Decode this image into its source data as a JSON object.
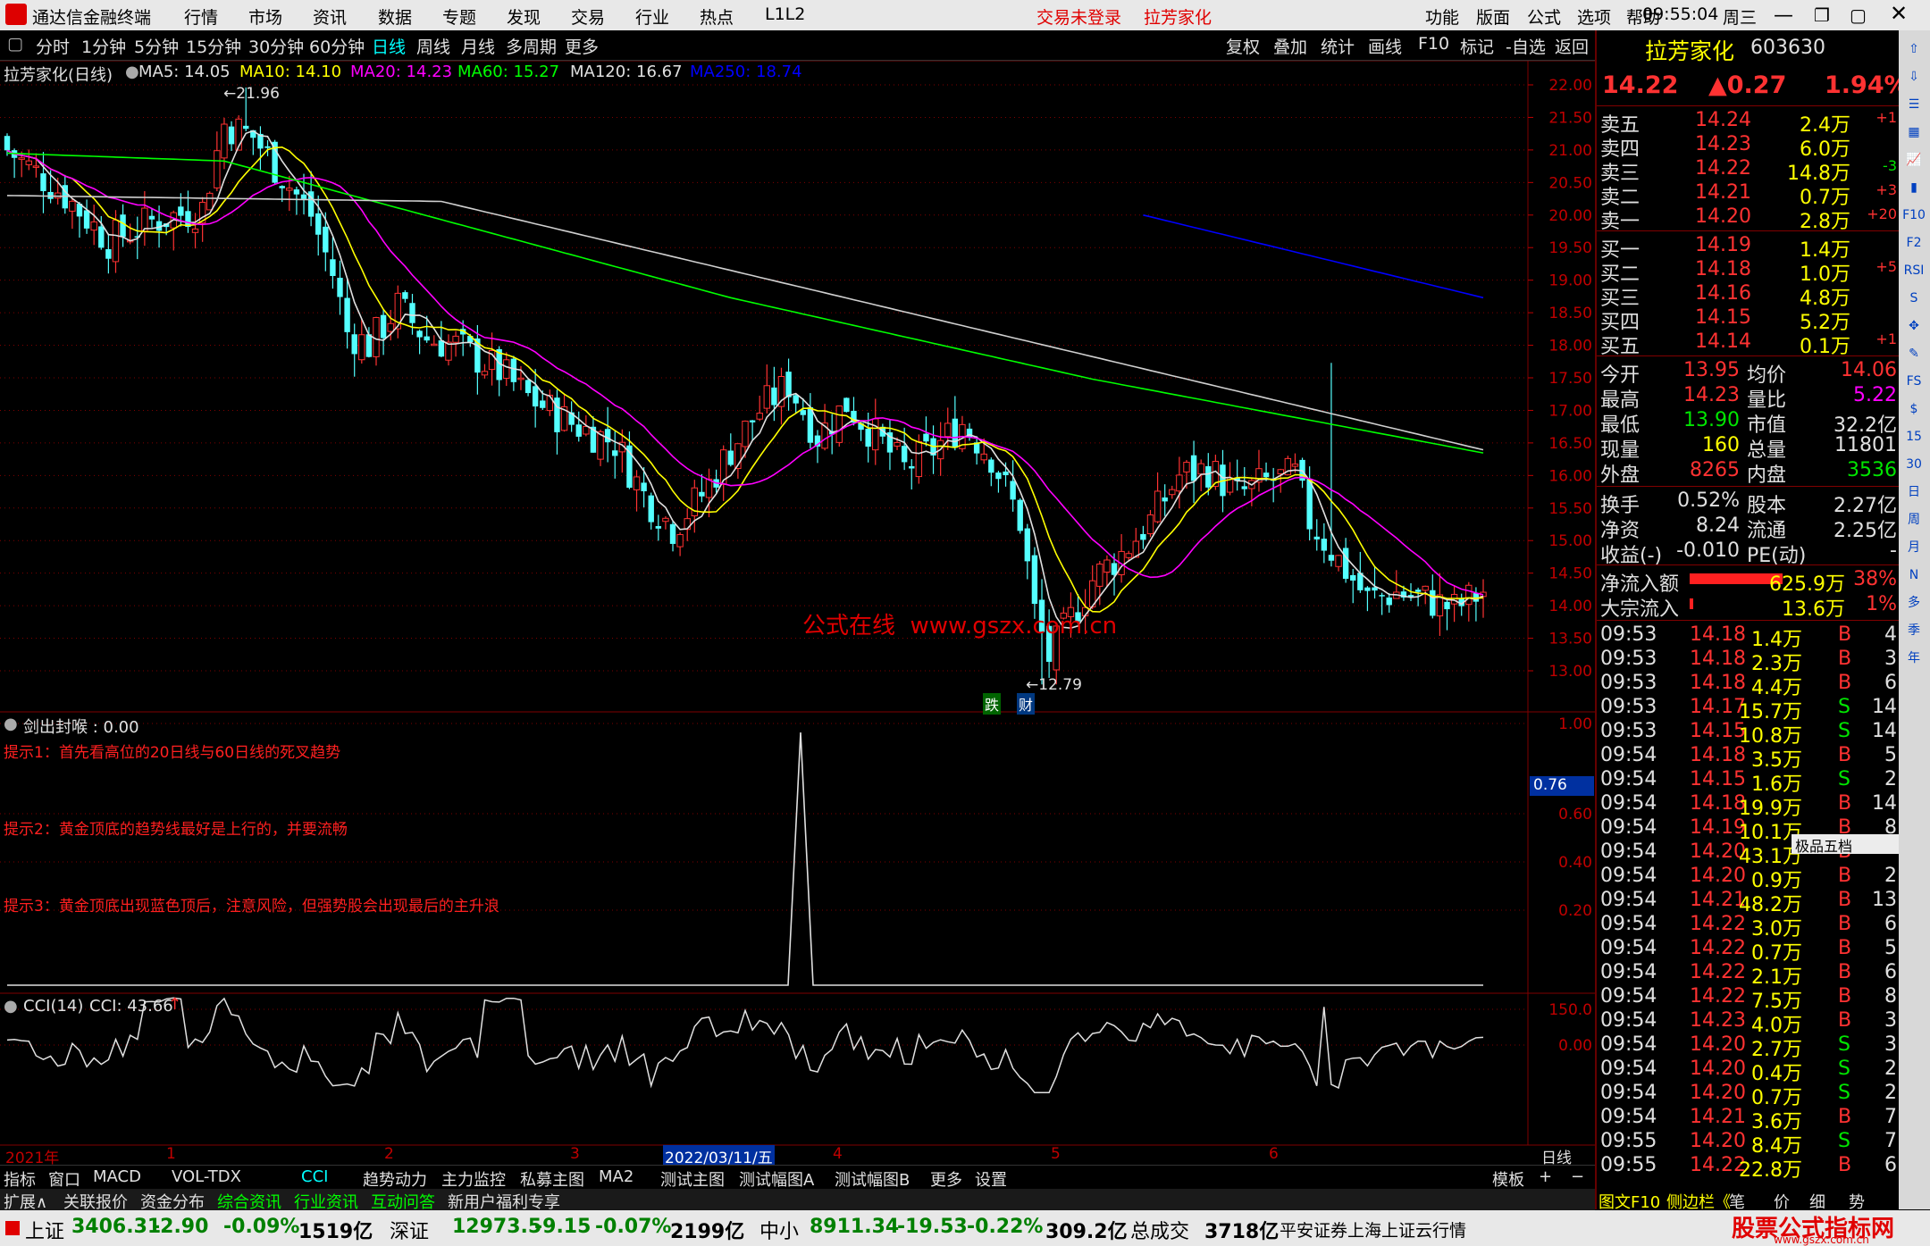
{
  "titlebar": {
    "app_title": "通达信金融终端",
    "menu": [
      "行情",
      "市场",
      "资讯",
      "数据",
      "专题",
      "发现",
      "交易",
      "行业",
      "热点",
      "L1L2"
    ],
    "login_status": "交易未登录",
    "stock_name": "拉芳家化",
    "right_menu": [
      "功能",
      "版面",
      "公式",
      "选项",
      "帮助"
    ],
    "time": "09:55:04",
    "weekday": "周三"
  },
  "period_tabs": [
    "分时",
    "1分钟",
    "5分钟",
    "15分钟",
    "30分钟",
    "60分钟",
    "日线",
    "周线",
    "月线",
    "多周期",
    "更多"
  ],
  "active_period": "日线",
  "chart_tools": [
    "复权",
    "叠加",
    "统计",
    "画线",
    "F10",
    "标记",
    "-自选",
    "返回"
  ],
  "main_chart": {
    "title": "拉芳家化(日线)",
    "ma_labels": [
      {
        "text": "MA5: 14.05",
        "color": "#e0e0e0"
      },
      {
        "text": "MA10: 14.10",
        "color": "#ffff00"
      },
      {
        "text": "MA20: 14.23",
        "color": "#ff00ff"
      },
      {
        "text": "MA60: 15.27",
        "color": "#00ff00"
      },
      {
        "text": "MA120: 16.67",
        "color": "#e0e0e0"
      },
      {
        "text": "MA250: 18.74",
        "color": "#0000ff"
      }
    ],
    "high_label": "21.96",
    "low_label": "12.79",
    "watermark": "公式在线  www.gszx.com.cn",
    "marker1": "跌",
    "marker2": "财",
    "y_ticks": [
      "22.00",
      "21.50",
      "21.00",
      "20.50",
      "20.00",
      "19.50",
      "19.00",
      "18.50",
      "18.00",
      "17.50",
      "17.00",
      "16.50",
      "16.00",
      "15.50",
      "15.00",
      "14.50",
      "14.00",
      "13.50",
      "13.00"
    ]
  },
  "indicator1": {
    "title": "剑出封喉 : 0.00",
    "hint1": "提示1：首先看高位的20日线与60日线的死叉趋势",
    "hint2": "提示2：黄金顶底的趋势线最好是上行的，并要流畅",
    "hint3": "提示3：黄金顶底出现蓝色顶后，注意风险，但强势股会出现最后的主升浪",
    "y_ticks": [
      "1.00",
      "0.60",
      "0.40",
      "0.20"
    ],
    "current_value": "0.76"
  },
  "indicator2": {
    "title": "CCI(14)",
    "value_label": "CCI: 43.66",
    "y_ticks": [
      "150.0",
      "0.00"
    ]
  },
  "x_axis": {
    "labels": [
      "2021年",
      "1",
      "2",
      "3",
      "2022/03/11/五",
      "4",
      "5",
      "6"
    ],
    "right_label": "日线"
  },
  "indicator_tabs": [
    "指标",
    "窗口",
    "MACD",
    "VOL-TDX",
    "CCI",
    "趋势动力",
    "主力监控",
    "私募主图",
    "MA2",
    "测试主图",
    "测试幅图A",
    "测试幅图B",
    "更多",
    "设置"
  ],
  "template_label": "模板",
  "bottom_tabs": [
    "扩展∧",
    "关联报价",
    "资金分布",
    "综合资讯",
    "行业资讯",
    "互动问答",
    "新用户福利专享"
  ],
  "quote": {
    "name": "拉芳家化",
    "code": "603630",
    "price": "14.22",
    "change": "▲0.27",
    "pct": "1.94%",
    "asks": [
      {
        "label": "卖五",
        "price": "14.24",
        "vol": "2.4万",
        "chg": "+1"
      },
      {
        "label": "卖四",
        "price": "14.23",
        "vol": "6.0万",
        "chg": ""
      },
      {
        "label": "卖三",
        "price": "14.22",
        "vol": "14.8万",
        "chg": "-3"
      },
      {
        "label": "卖二",
        "price": "14.21",
        "vol": "0.7万",
        "chg": "+3"
      },
      {
        "label": "卖一",
        "price": "14.20",
        "vol": "2.8万",
        "chg": "+20"
      }
    ],
    "bids": [
      {
        "label": "买一",
        "price": "14.19",
        "vol": "1.4万",
        "chg": ""
      },
      {
        "label": "买二",
        "price": "14.18",
        "vol": "1.0万",
        "chg": "+5"
      },
      {
        "label": "买三",
        "price": "14.16",
        "vol": "4.8万",
        "chg": ""
      },
      {
        "label": "买四",
        "price": "14.15",
        "vol": "5.2万",
        "chg": ""
      },
      {
        "label": "买五",
        "price": "14.14",
        "vol": "0.1万",
        "chg": "+1"
      }
    ],
    "stats": [
      {
        "l1": "今开",
        "v1": "13.95",
        "l2": "均价",
        "v2": "14.06"
      },
      {
        "l1": "最高",
        "v1": "14.23",
        "l2": "量比",
        "v2": "5.22"
      },
      {
        "l1": "最低",
        "v1": "13.90",
        "l2": "市值",
        "v2": "32.2亿"
      },
      {
        "l1": "现量",
        "v1": "160",
        "l2": "总量",
        "v2": "11801"
      },
      {
        "l1": "外盘",
        "v1": "8265",
        "l2": "内盘",
        "v2": "3536"
      }
    ],
    "fund": [
      {
        "l1": "换手",
        "v1": "0.52%",
        "l2": "股本",
        "v2": "2.27亿"
      },
      {
        "l1": "净资",
        "v1": "8.24",
        "l2": "流通",
        "v2": "2.25亿"
      },
      {
        "l1": "收益(-)",
        "v1": "-0.010",
        "l2": "PE(动)",
        "v2": "-"
      }
    ],
    "flow": [
      {
        "l": "净流入额",
        "v": "625.9万",
        "p": "38%"
      },
      {
        "l": "大宗流入",
        "v": "13.6万",
        "p": "1%"
      }
    ],
    "ticks": [
      [
        "09:53",
        "14.18",
        "1.4万",
        "B",
        "4"
      ],
      [
        "09:53",
        "14.18",
        "2.3万",
        "B",
        "3"
      ],
      [
        "09:53",
        "14.18",
        "4.4万",
        "B",
        "6"
      ],
      [
        "09:53",
        "14.17",
        "15.7万",
        "S",
        "14"
      ],
      [
        "09:53",
        "14.15",
        "10.8万",
        "S",
        "14"
      ],
      [
        "09:54",
        "14.18",
        "3.5万",
        "B",
        "5"
      ],
      [
        "09:54",
        "14.15",
        "1.6万",
        "S",
        "2"
      ],
      [
        "09:54",
        "14.18",
        "19.9万",
        "B",
        "14"
      ],
      [
        "09:54",
        "14.19",
        "10.1万",
        "B",
        "8"
      ],
      [
        "09:54",
        "14.20",
        "43.1万",
        "B",
        ""
      ],
      [
        "09:54",
        "14.20",
        "0.9万",
        "B",
        "2"
      ],
      [
        "09:54",
        "14.21",
        "48.2万",
        "B",
        "13"
      ],
      [
        "09:54",
        "14.22",
        "3.0万",
        "B",
        "6"
      ],
      [
        "09:54",
        "14.22",
        "0.7万",
        "B",
        "5"
      ],
      [
        "09:54",
        "14.22",
        "2.1万",
        "B",
        "6"
      ],
      [
        "09:54",
        "14.22",
        "7.5万",
        "B",
        "8"
      ],
      [
        "09:54",
        "14.23",
        "4.0万",
        "B",
        "3"
      ],
      [
        "09:54",
        "14.20",
        "2.7万",
        "S",
        "3"
      ],
      [
        "09:54",
        "14.20",
        "0.4万",
        "S",
        "2"
      ],
      [
        "09:54",
        "14.20",
        "0.7万",
        "S",
        "2"
      ],
      [
        "09:54",
        "14.21",
        "3.6万",
        "B",
        "7"
      ],
      [
        "09:55",
        "14.20",
        "8.4万",
        "S",
        "7"
      ],
      [
        "09:55",
        "14.22",
        "22.8万",
        "B",
        "6"
      ]
    ],
    "popup_label": "极品五档",
    "bottom_tabs": [
      "图文F10",
      "侧边栏《",
      "笔",
      "价",
      "细",
      "势"
    ]
  },
  "side_icons": [
    "up-arrow",
    "down-arrow",
    "list",
    "grid",
    "chart",
    "bars",
    "F10",
    "F2",
    "RSI",
    "S",
    "move",
    "pen",
    "FS",
    "dollar",
    "15",
    "30",
    "日",
    "周",
    "月",
    "N",
    "多",
    "季",
    "年"
  ],
  "statusbar": {
    "items": [
      {
        "name": "上证",
        "val": "3406.31",
        "chg": "-2.90",
        "pct": "-0.09%",
        "amt": "1519亿"
      },
      {
        "name": "深证",
        "val": "12973.5",
        "chg": "-9.15",
        "pct": "-0.07%",
        "amt": "2199亿"
      },
      {
        "name": "中小",
        "val": "8911.34",
        "chg": "-19.53",
        "pct": "-0.22%",
        "amt": "309.2亿"
      }
    ],
    "total_label": "总成交",
    "total": "3718亿",
    "broker": "平安证券上海上证云行情",
    "logo": "股票公式指标网",
    "logo_url": "www.gszx.com.cn"
  }
}
